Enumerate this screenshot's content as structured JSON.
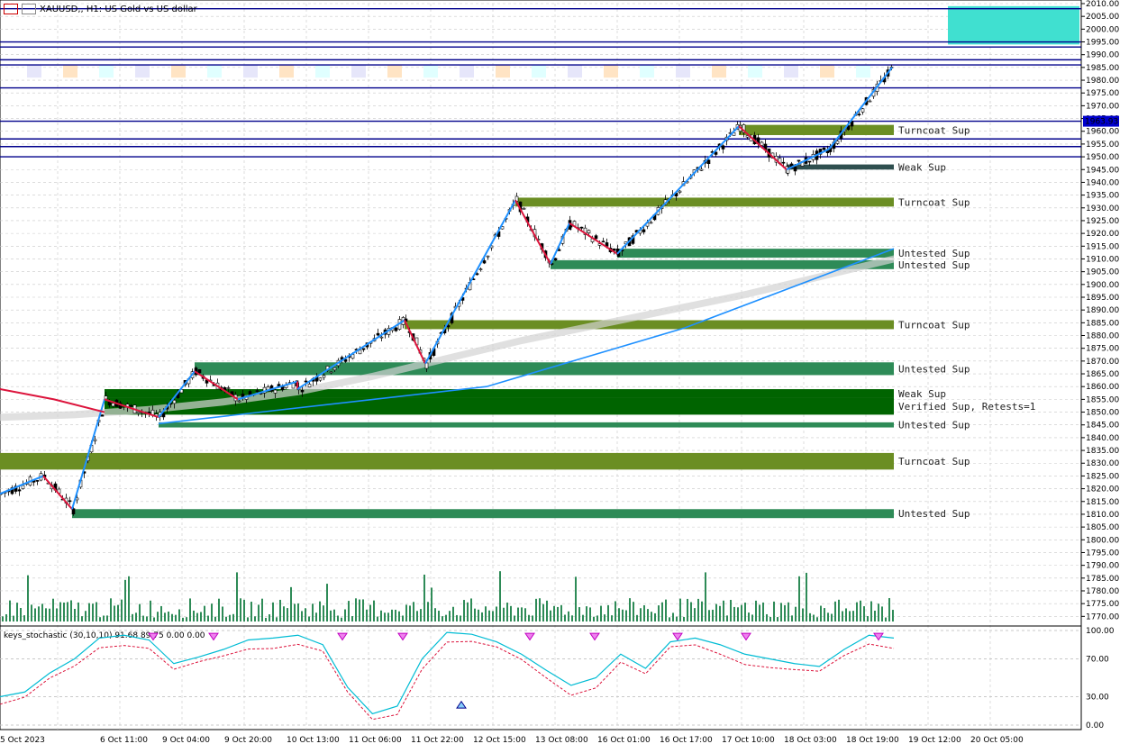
{
  "header": {
    "title": "XAUUSD,, H1: US Gold vs US dollar"
  },
  "indicator": {
    "label": "keys_stochastic (30,10,10) 91.68 89.75 0.00 0.00",
    "levels": [
      "100.00",
      "70.00",
      "30.00",
      "0.00"
    ]
  },
  "chart_data": {
    "type": "line",
    "title": "XAUUSD,, H1: US Gold vs US dollar",
    "price_axis": {
      "ylim": [
        1768,
        2010
      ],
      "ticks": [
        2010,
        2005,
        2000,
        1995,
        1990,
        1985,
        1980,
        1975,
        1970,
        1965,
        1960,
        1955,
        1950,
        1945,
        1940,
        1935,
        1930,
        1925,
        1920,
        1915,
        1910,
        1905,
        1900,
        1895,
        1890,
        1885,
        1880,
        1875,
        1870,
        1865,
        1860,
        1855,
        1850,
        1845,
        1840,
        1835,
        1830,
        1825,
        1820,
        1815,
        1810,
        1805,
        1800,
        1795,
        1790,
        1785,
        1780,
        1775,
        1770
      ],
      "tick_labels": [
        "2010.00",
        "2005.00",
        "2000.00",
        "1995.00",
        "1990.00",
        "1985.00",
        "1980.00",
        "1975.00",
        "1970.00",
        "1965.00",
        "1960.00",
        "1955.00",
        "1950.00",
        "1945.00",
        "1940.00",
        "1935.00",
        "1930.00",
        "1925.00",
        "1920.00",
        "1915.00",
        "1910.00",
        "1905.00",
        "1900.00",
        "1895.00",
        "1890.00",
        "1885.00",
        "1880.00",
        "1875.00",
        "1870.00",
        "1865.00",
        "1860.00",
        "1855.00",
        "1850.00",
        "1845.00",
        "1840.00",
        "1835.00",
        "1830.00",
        "1825.00",
        "1820.00",
        "1815.00",
        "1810.00",
        "1805.00",
        "1800.00",
        "1795.00",
        "1790.00",
        "1785.00",
        "1780.00",
        "1775.00",
        "1770.00"
      ],
      "highlight": {
        "value": 1963.93,
        "label": "1963.93"
      }
    },
    "time_axis": {
      "labels": [
        "5 Oct 2023",
        "6 Oct 11:00",
        "9 Oct 04:00",
        "9 Oct 20:00",
        "10 Oct 13:00",
        "11 Oct 06:00",
        "11 Oct 22:00",
        "12 Oct 15:00",
        "13 Oct 08:00",
        "16 Oct 01:00",
        "16 Oct 17:00",
        "17 Oct 10:00",
        "18 Oct 03:00",
        "18 Oct 19:00",
        "19 Oct 12:00",
        "20 Oct 05:00"
      ]
    },
    "horizontal_lines": [
      2008,
      1995,
      1993,
      1988,
      1986,
      1977,
      1963.93,
      1957,
      1954,
      1950
    ],
    "zones": [
      {
        "label": "Turncoat Sup",
        "from": 1958.5,
        "to": 1962.5,
        "color": "#6b8e23"
      },
      {
        "label": "Weak Sup",
        "from": 1945,
        "to": 1947,
        "color": "#2f4f4f"
      },
      {
        "label": "Turncoat Sup",
        "from": 1930.5,
        "to": 1934,
        "color": "#6b8e23"
      },
      {
        "label": "Untested Sup",
        "from": 1910.5,
        "to": 1914,
        "color": "#2e8b57"
      },
      {
        "label": "Untested Sup",
        "from": 1906,
        "to": 1909.5,
        "color": "#2e8b57"
      },
      {
        "label": "Turncoat Sup",
        "from": 1882.5,
        "to": 1886,
        "color": "#6b8e23"
      },
      {
        "label": "Untested Sup",
        "from": 1864.5,
        "to": 1869.5,
        "color": "#2e8b57"
      },
      {
        "label": "Weak Sup",
        "from": 1855.5,
        "to": 1859,
        "color": "#006400"
      },
      {
        "label": "Verified Sup, Retests=1",
        "from": 1849,
        "to": 1855.5,
        "color": "#006400"
      },
      {
        "label": "Untested Sup",
        "from": 1844,
        "to": 1846,
        "color": "#2e8b57"
      },
      {
        "label": "Turncoat Sup",
        "from": 1827.5,
        "to": 1834,
        "color": "#6b8e23"
      },
      {
        "label": "Untested Sup",
        "from": 1808.5,
        "to": 1812,
        "color": "#2e8b57"
      }
    ],
    "series": [
      {
        "values": [
          1818,
          1825,
          1812,
          1855,
          1848,
          1866,
          1855,
          1862,
          1859,
          1886,
          1869,
          1933,
          1908,
          1924,
          1912,
          1962,
          1945,
          1953,
          1985
        ]
      },
      {
        "values": [
          1818,
          1825,
          1812,
          1855,
          1848,
          1866,
          1855,
          1862,
          1859,
          1886,
          1869,
          1933,
          1908,
          1924,
          1912,
          1962,
          1945,
          1953,
          1985
        ]
      },
      {
        "values": [
          1848,
          1849,
          1851,
          1854,
          1858,
          1864,
          1871,
          1878,
          1884,
          1890,
          1896,
          1903,
          1910
        ]
      }
    ]
  }
}
